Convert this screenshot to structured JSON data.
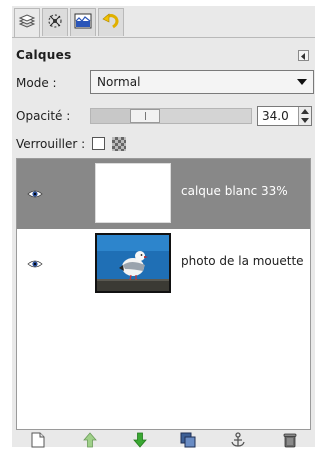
{
  "dialog": {
    "title": "Calques"
  },
  "tabs": [
    {
      "icon": "layers-icon",
      "active": true
    },
    {
      "icon": "channels-icon",
      "active": false
    },
    {
      "icon": "paths-icon",
      "active": false
    },
    {
      "icon": "undo-history-icon",
      "active": false
    }
  ],
  "mode": {
    "label": "Mode :",
    "value": "Normal"
  },
  "opacity": {
    "label": "Opacité :",
    "value": "34.0",
    "fraction": 0.34
  },
  "lock": {
    "label": "Verrouiller :",
    "lock_pixels": false,
    "lock_alpha_icon": "alpha-lock-icon"
  },
  "layers": [
    {
      "name": "calque blanc 33%",
      "visible": true,
      "selected": true,
      "thumbnail": "white"
    },
    {
      "name": "photo de la mouette",
      "visible": true,
      "selected": false,
      "thumbnail": "seagull-photo"
    }
  ],
  "footer_buttons": [
    "new-layer-icon",
    "raise-layer-icon",
    "lower-layer-icon",
    "duplicate-layer-icon",
    "anchor-layer-icon",
    "delete-layer-icon"
  ],
  "colors": {
    "selected_row": "#888888",
    "arrow_green": "#3aa832",
    "tab_undo_yellow": "#f2c200"
  }
}
